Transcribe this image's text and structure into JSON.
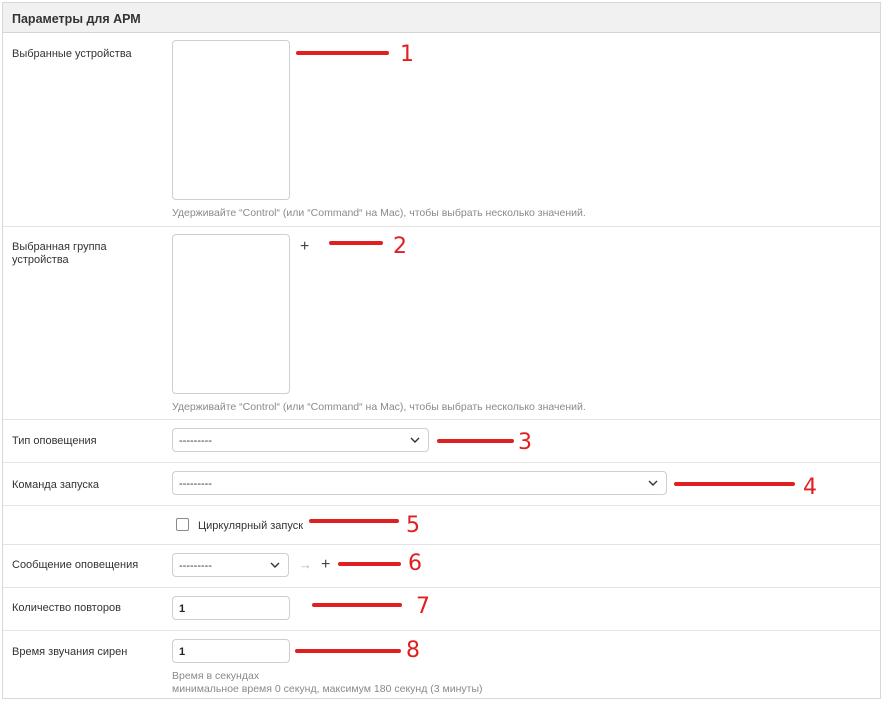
{
  "header": {
    "title": "Параметры для АРМ"
  },
  "fields": {
    "devices": {
      "label": "Выбранные устройства",
      "help": "Удерживайте “Control“ (или “Command“ на Mac), чтобы выбрать несколько значений."
    },
    "device_group": {
      "label": "Выбранная группа устройства",
      "help": "Удерживайте “Control“ (или “Command“ на Mac), чтобы выбрать несколько значений.",
      "add_label": "+"
    },
    "alert_type": {
      "label": "Тип оповещения",
      "value": "---------"
    },
    "start_command": {
      "label": "Команда запуска",
      "value": "---------"
    },
    "circular_start": {
      "label": "Циркулярный запуск",
      "checked": false
    },
    "alert_message": {
      "label": "Сообщение оповещения",
      "value": "---------",
      "arrow": "→",
      "add_label": "+"
    },
    "repeat_count": {
      "label": "Количество повторов",
      "value": "1"
    },
    "siren_time": {
      "label": "Время звучания сирен",
      "value": "1",
      "help_line1": "Время в секундах",
      "help_line2": "минимальное время 0 секунд, максимум 180 секунд (3 минуты)"
    }
  },
  "annotations": [
    "1",
    "2",
    "3",
    "4",
    "5",
    "6",
    "7",
    "8"
  ],
  "colors": {
    "annotation": "#e02020",
    "header_bg": "#f1f1f1"
  },
  "icons": {
    "select_chevron": "chevron-down-icon",
    "add": "plus-icon",
    "arrow": "arrow-right-icon"
  }
}
